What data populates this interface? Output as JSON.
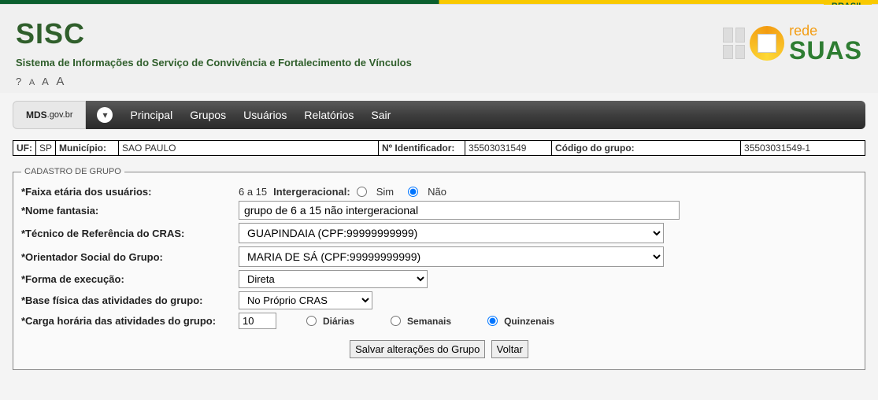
{
  "brasil_label": "BRASIL",
  "header": {
    "title": "SISC",
    "subtitle": "Sistema de Informações do Serviço de Convivência e Fortalecimento de Vínculos",
    "help_glyph": "?",
    "font_a1": "A",
    "font_a2": "A",
    "font_a3": "A"
  },
  "logo": {
    "rede": "rede",
    "suas": "SUAS"
  },
  "nav": {
    "brand_main": "MDS",
    "brand_tld": ".gov.br",
    "items": [
      "Principal",
      "Grupos",
      "Usuários",
      "Relatórios",
      "Sair"
    ]
  },
  "info": {
    "uf_label": "UF:",
    "uf_value": "SP",
    "municipio_label": "Município:",
    "municipio_value": "SAO PAULO",
    "identificador_label": "Nº Identificador:",
    "identificador_value": "35503031549",
    "codigo_grupo_label": "Código do grupo:",
    "codigo_grupo_value": "35503031549-1"
  },
  "form": {
    "legend": "CADASTRO DE GRUPO",
    "faixa_label": "*Faixa etária dos usuários:",
    "faixa_value": "6 a 15",
    "interger_label": "Intergeracional:",
    "sim_label": "Sim",
    "nao_label": "Não",
    "nome_label": "*Nome fantasia:",
    "nome_value": "grupo de 6 a 15 não intergeracional",
    "tecnico_label": "*Técnico de Referência do CRAS:",
    "tecnico_value": "GUAPINDAIA (CPF:99999999999)",
    "orientador_label": "*Orientador Social do Grupo:",
    "orientador_value": "MARIA DE SÁ (CPF:99999999999)",
    "forma_label": "*Forma de execução:",
    "forma_value": "Direta",
    "base_label": "*Base física das atividades do grupo:",
    "base_value": "No Próprio CRAS",
    "carga_label": "*Carga horária das atividades do grupo:",
    "carga_value": "10",
    "freq_diarias": "Diárias",
    "freq_semanais": "Semanais",
    "freq_quinzenais": "Quinzenais",
    "btn_salvar": "Salvar alterações do Grupo",
    "btn_voltar": "Voltar"
  }
}
